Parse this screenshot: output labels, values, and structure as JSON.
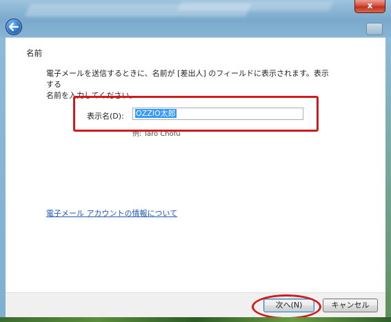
{
  "window": {
    "close_label": "x"
  },
  "page": {
    "heading": "名前",
    "description_line1": "電子メールを送信するときに、名前が [差出人] のフィールドに表示されます。表示する",
    "description_line2": "名前を入力してください。",
    "display_name_label": "表示名(D):",
    "display_name_value": "OZZIO太郎",
    "example_text": "例: Taro Chofu",
    "info_link": "電子メール アカウントの情報について"
  },
  "footer": {
    "next_label": "次へ(N)",
    "cancel_label": "キャンセル"
  },
  "colors": {
    "highlight": "#d21a1a",
    "link": "#1b58b8",
    "selection": "#3399ff"
  }
}
